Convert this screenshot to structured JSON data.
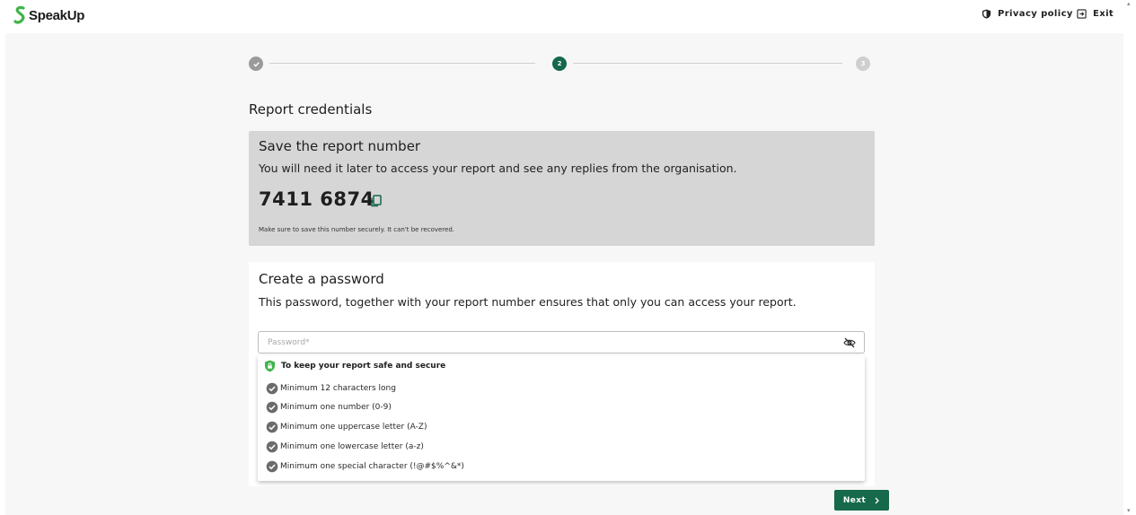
{
  "header": {
    "brand": "SpeakUp",
    "privacy_label": "Privacy policy",
    "exit_label": "Exit"
  },
  "stepper": {
    "current": 2,
    "steps": [
      {
        "state": "completed",
        "label": ""
      },
      {
        "state": "active",
        "label": "2"
      },
      {
        "state": "pending",
        "label": "3"
      }
    ]
  },
  "page": {
    "section_title": "Report credentials"
  },
  "report_number_card": {
    "title": "Save the report number",
    "description": "You will need it later to access your report and see any replies from the organisation.",
    "number": "7411 6874",
    "note": "Make sure to save this number securely. It can't be recovered."
  },
  "password_card": {
    "title": "Create a password",
    "description": "This password, together with your report number ensures that only you can access your report.",
    "placeholder": "Password*"
  },
  "requirements": {
    "title": "To keep your report safe and secure",
    "items": [
      "Minimum 12 characters long",
      "Minimum one number (0-9)",
      "Minimum one uppercase letter (A-Z)",
      "Minimum one lowercase letter (a-z)",
      "Minimum one special character (!@#$%^&*)"
    ]
  },
  "actions": {
    "next_label": "Next"
  },
  "colors": {
    "accent": "#16694b",
    "brand_green": "#3fb44a",
    "card_gray": "#d6d6d6"
  },
  "icons": {
    "logo": "speakup-s-logo",
    "privacy": "shield-icon",
    "exit": "exit-icon",
    "copy": "copy-icon",
    "password_visibility": "eye-off-icon",
    "requirement": "check-circle-icon",
    "secure": "shield-check-icon",
    "next": "chevron-right-icon"
  }
}
